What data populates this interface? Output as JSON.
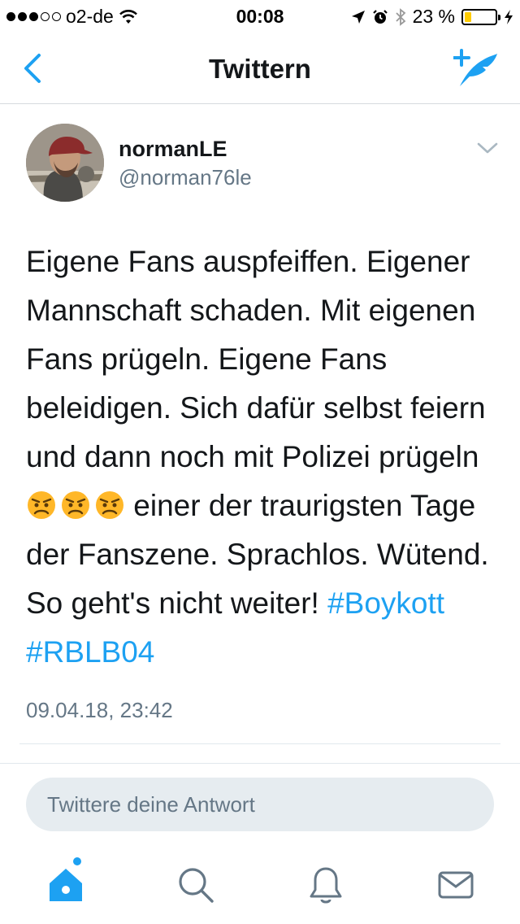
{
  "status_bar": {
    "carrier": "o2-de",
    "time": "00:08",
    "battery": "23 %",
    "battery_level": 0.23
  },
  "nav": {
    "title": "Twittern",
    "back_icon": "chevron-left-icon",
    "compose_icon": "compose-tweet-icon"
  },
  "tweet": {
    "author_name": "normanLE",
    "author_handle": "@norman76le",
    "text_before_emoji": "Eigene Fans auspfeiffen. Eigener Mannschaft schaden. Mit eigenen Fans prügeln. Eigene Fans beleidigen. Sich dafür selbst feiern und dann noch mit Polizei prügeln",
    "emojis": [
      "angry-face-icon",
      "angry-face-icon",
      "angry-face-icon"
    ],
    "text_after_emoji": " einer der traurigsten Tage der Fanszene. Sprachlos. Wütend. So geht's nicht weiter! ",
    "hashtags": [
      "#Boykott",
      "#RBLB04"
    ],
    "timestamp": "09.04.18, 23:42"
  },
  "reply": {
    "placeholder": "Twittere deine Antwort"
  },
  "tabbar": {
    "items": [
      "home-icon",
      "search-icon",
      "notifications-icon",
      "messages-icon"
    ],
    "active": "home-icon"
  },
  "colors": {
    "accent": "#1da1f2",
    "text": "#14171a",
    "secondary": "#657786",
    "reply_bg": "#e6ecf0"
  }
}
